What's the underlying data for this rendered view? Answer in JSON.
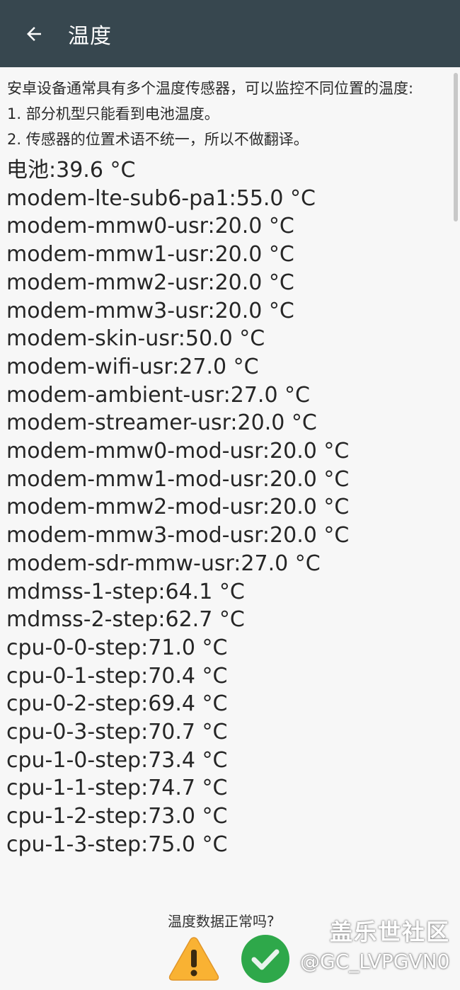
{
  "app_bar": {
    "title": "温度",
    "back_icon": "arrow-left-icon"
  },
  "intro": {
    "line1": "安卓设备通常具有多个温度传感器，可以监控不同位置的温度:",
    "line2": "1. 部分机型只能看到电池温度。",
    "line3": "2. 传感器的位置术语不统一，所以不做翻译。"
  },
  "readings": [
    "电池:39.6 °C",
    "modem-lte-sub6-pa1:55.0 °C",
    "modem-mmw0-usr:20.0 °C",
    "modem-mmw1-usr:20.0 °C",
    "modem-mmw2-usr:20.0 °C",
    "modem-mmw3-usr:20.0 °C",
    "modem-skin-usr:50.0 °C",
    "modem-wifi-usr:27.0 °C",
    "modem-ambient-usr:27.0 °C",
    "modem-streamer-usr:20.0 °C",
    "modem-mmw0-mod-usr:20.0 °C",
    "modem-mmw1-mod-usr:20.0 °C",
    "modem-mmw2-mod-usr:20.0 °C",
    "modem-mmw3-mod-usr:20.0 °C",
    "modem-sdr-mmw-usr:27.0 °C",
    "mdmss-1-step:64.1 °C",
    "mdmss-2-step:62.7 °C",
    "cpu-0-0-step:71.0 °C",
    "cpu-0-1-step:70.4 °C",
    "cpu-0-2-step:69.4 °C",
    "cpu-0-3-step:70.7 °C",
    "cpu-1-0-step:73.4 °C",
    "cpu-1-1-step:74.7 °C",
    "cpu-1-2-step:73.0 °C",
    "cpu-1-3-step:75.0 °C"
  ],
  "feedback": {
    "question": "温度数据正常吗?",
    "warning_icon": "warning-icon",
    "ok_icon": "check-circle-icon"
  },
  "watermark": {
    "site": "盖乐世社区",
    "user": "@GC_LVPGVN0"
  },
  "colors": {
    "app_bar": "#37474f",
    "background": "#f7f7f7",
    "warning": "#f9b233",
    "ok": "#2ea84a"
  }
}
